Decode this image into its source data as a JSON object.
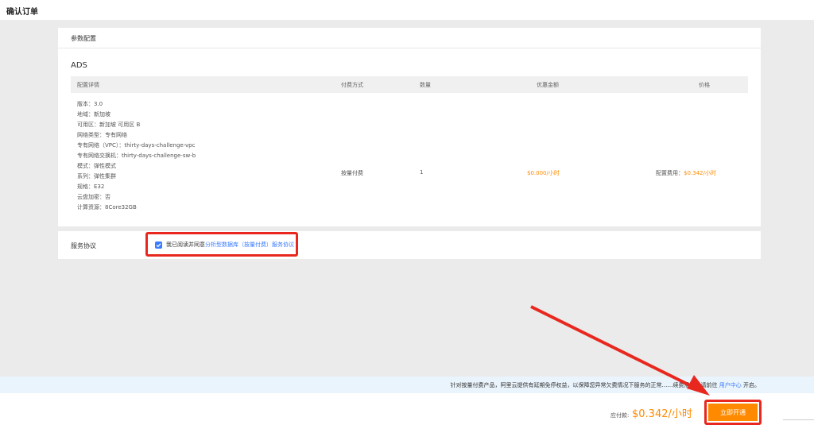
{
  "header": {
    "title": "确认订单"
  },
  "config": {
    "section_title": "参数配置",
    "product_name": "ADS",
    "table": {
      "headers": {
        "detail": "配置详情",
        "payment": "付费方式",
        "quantity": "数量",
        "discount": "优惠金额",
        "price": "价格"
      },
      "details": [
        "版本：3.0",
        "地域：新加坡",
        "可用区：新加坡 可用区 B",
        "网络类型：专有网络",
        "专有网络（VPC）：thirty-days-challenge-vpc",
        "专有网络交换机：thirty-days-challenge-sw-b",
        "模式：弹性模式",
        "系列：弹性集群",
        "规格：E32",
        "云盘加密：否",
        "计算资源：8Core32GB"
      ],
      "payment": "按量付费",
      "quantity": "1",
      "discount": "$0.000/小时",
      "price_label": "配置费用：",
      "price_value": "$0.342/小时"
    }
  },
  "agreement": {
    "label": "服务协议",
    "checked": true,
    "text": "我已阅读并同意",
    "link": "分析型数据库（按量付费）服务协议"
  },
  "notice": {
    "text": "针对按量付费产品，阿里云提供有延期免停权益，以保障您异常欠费情况下服务的正常……续费需要，请前往",
    "link": "用户中心",
    "suffix": "开启。"
  },
  "footer": {
    "total_label": "应付款:",
    "total_amount": "$0.342/小时",
    "submit_label": "立即开通"
  },
  "colors": {
    "accent": "#ff8a00",
    "link": "#3a7cff",
    "highlight": "#e8281e"
  }
}
